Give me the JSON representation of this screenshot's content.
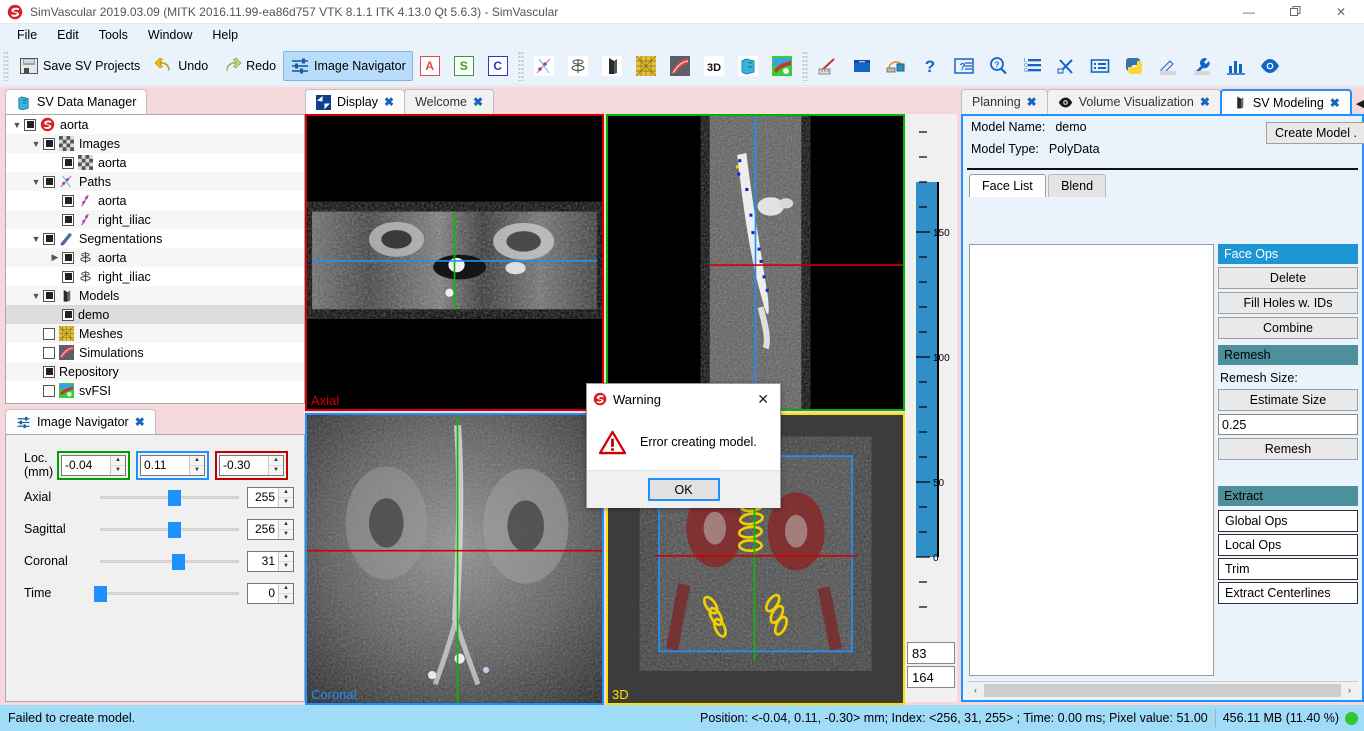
{
  "window": {
    "title": "SimVascular 2019.03.09 (MITK 2016.11.99-ea86d757 VTK 8.1.1 ITK 4.13.0 Qt 5.6.3) - SimVascular",
    "minimize": "—",
    "maximize": "❐",
    "close": "✕"
  },
  "menubar": {
    "items": [
      "File",
      "Edit",
      "Tools",
      "Window",
      "Help"
    ]
  },
  "toolbar": {
    "save_label": "Save SV Projects",
    "undo_label": "Undo",
    "redo_label": "Redo",
    "image_navigator_label": "Image Navigator",
    "letter_a": "A",
    "letter_s": "S",
    "letter_c": "C"
  },
  "data_manager": {
    "tab_label": "SV Data Manager",
    "tree": [
      {
        "label": "aorta",
        "depth": 0,
        "arrow": "down",
        "checked": true,
        "icon": "sv-logo-icon",
        "selected": false
      },
      {
        "label": "Images",
        "depth": 1,
        "arrow": "down",
        "checked": true,
        "icon": "images-icon",
        "selected": false
      },
      {
        "label": "aorta",
        "depth": 2,
        "arrow": "",
        "checked": true,
        "icon": "image-icon",
        "selected": false
      },
      {
        "label": "Paths",
        "depth": 1,
        "arrow": "down",
        "checked": true,
        "icon": "paths-icon",
        "selected": false
      },
      {
        "label": "aorta",
        "depth": 2,
        "arrow": "",
        "checked": true,
        "icon": "path-icon",
        "selected": false
      },
      {
        "label": "right_iliac",
        "depth": 2,
        "arrow": "",
        "checked": true,
        "icon": "path-icon",
        "selected": false
      },
      {
        "label": "Segmentations",
        "depth": 1,
        "arrow": "down",
        "checked": true,
        "icon": "segmentations-icon",
        "selected": false
      },
      {
        "label": "aorta",
        "depth": 2,
        "arrow": "right",
        "checked": true,
        "icon": "segmentation-icon",
        "selected": false
      },
      {
        "label": "right_iliac",
        "depth": 2,
        "arrow": "",
        "checked": true,
        "icon": "segmentation-icon",
        "selected": false
      },
      {
        "label": "Models",
        "depth": 1,
        "arrow": "down",
        "checked": true,
        "icon": "models-icon",
        "selected": false
      },
      {
        "label": "demo",
        "depth": 2,
        "arrow": "",
        "checked": true,
        "icon": "",
        "selected": true
      },
      {
        "label": "Meshes",
        "depth": 1,
        "arrow": "",
        "checked": false,
        "icon": "meshes-icon",
        "selected": false
      },
      {
        "label": "Simulations",
        "depth": 1,
        "arrow": "",
        "checked": false,
        "icon": "simulations-icon",
        "selected": false
      },
      {
        "label": "Repository",
        "depth": 1,
        "arrow": "",
        "checked": true,
        "icon": "",
        "selected": false
      },
      {
        "label": "svFSI",
        "depth": 1,
        "arrow": "",
        "checked": false,
        "icon": "svfsi-icon",
        "selected": false
      }
    ]
  },
  "image_navigator": {
    "tab_label": "Image Navigator",
    "loc_label": "Loc. (mm)",
    "loc_values": [
      "-0.04",
      "0.11",
      "-0.30"
    ],
    "loc_colors": [
      "#00a000",
      "#1e90ff",
      "#c00000"
    ],
    "sliders": [
      {
        "label": "Axial",
        "value": "255",
        "pos": 0.53
      },
      {
        "label": "Sagittal",
        "value": "256",
        "pos": 0.53
      },
      {
        "label": "Coronal",
        "value": "31",
        "pos": 0.56
      },
      {
        "label": "Time",
        "value": "0",
        "pos": 0.0
      }
    ]
  },
  "editor": {
    "tabs": [
      {
        "label": "Display",
        "active": true
      },
      {
        "label": "Welcome",
        "active": false
      }
    ],
    "viewports": [
      {
        "label": "Axial",
        "border": "#d40000",
        "label_color": "#d40000"
      },
      {
        "label": "",
        "border": "#00b400",
        "label_color": "#00b400"
      },
      {
        "label": "Coronal",
        "border": "#1e90ff",
        "label_color": "#1e90ff"
      },
      {
        "label": "3D",
        "border": "#ffe000",
        "label_color": "#ffe000"
      }
    ],
    "scale_ticks": [
      "150",
      "100",
      "50",
      "0"
    ],
    "level_window": [
      "83",
      "164"
    ]
  },
  "right_panel": {
    "tabs": [
      {
        "label": "Planning",
        "active": false,
        "icon": ""
      },
      {
        "label": "Volume Visualization",
        "active": false,
        "icon": "eye-icon"
      },
      {
        "label": "SV Modeling",
        "active": true,
        "icon": "model-icon"
      }
    ],
    "nav_prev": "◀",
    "nav_next": "▶",
    "model_name_label": "Model Name:",
    "model_name_value": "demo",
    "model_type_label": "Model Type:",
    "model_type_value": "PolyData",
    "create_model_button": "Create Model .",
    "subtabs": [
      {
        "label": "Face List",
        "active": true
      },
      {
        "label": "Blend",
        "active": false
      }
    ],
    "face_ops_header": "Face Ops",
    "face_ops_buttons": [
      "Delete",
      "Fill Holes w. IDs",
      "Combine"
    ],
    "remesh_header": "Remesh",
    "remesh_size_label": "Remesh Size:",
    "estimate_size_button": "Estimate Size",
    "remesh_size_value": "0.25",
    "remesh_button": "Remesh",
    "extract_header": "Extract",
    "accordion_items": [
      "Global Ops",
      "Local Ops",
      "Trim",
      "Extract Centerlines"
    ],
    "scroll_left": "‹",
    "scroll_right": "›"
  },
  "dialog": {
    "title": "Warning",
    "close": "✕",
    "message": "Error creating model.",
    "ok_button": "OK"
  },
  "statusbar": {
    "left": "Failed to create model.",
    "position": "Position: <-0.04, 0.11, -0.30> mm; Index: <256, 31, 255> ; Time: 0.00 ms; Pixel value: 51.00",
    "memory": "456.11 MB (11.40 %)"
  }
}
